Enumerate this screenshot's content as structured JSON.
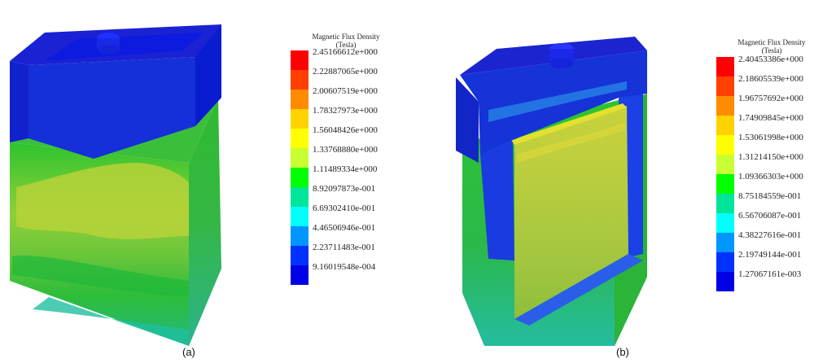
{
  "legend_colors": [
    "#ff0000",
    "#ff4000",
    "#ff8c00",
    "#ffd200",
    "#ffff00",
    "#c8ff32",
    "#00ff00",
    "#00e59a",
    "#00ffff",
    "#0096ff",
    "#0032ff",
    "#0000e6"
  ],
  "panel_a": {
    "legend_title_line1": "Magnetic Flux Density",
    "legend_title_line2": "(Tesla)",
    "legend_values": [
      "2.45166612e+000",
      "2.22887065e+000",
      "2.00607519e+000",
      "1.78327973e+000",
      "1.56048426e+000",
      "1.33768880e+000",
      "1.11489334e+000",
      "8.92097873e-001",
      "6.69302410e-001",
      "4.46506946e-001",
      "2.23711483e-001",
      "9.16019548e-004"
    ],
    "caption": "(a)"
  },
  "panel_b": {
    "legend_title_line1": "Magnetic Flux Density",
    "legend_title_line2": "(Tesla)",
    "legend_values": [
      "2.40453386e+000",
      "2.18605539e+000",
      "1.96757692e+000",
      "1.74909845e+000",
      "1.53061998e+000",
      "1.31214150e+000",
      "1.09366303e+000",
      "8.75184559e-001",
      "6.56706087e-001",
      "4.38227616e-001",
      "2.19749144e-001",
      "1.27067161e-003"
    ],
    "caption": "(b)"
  }
}
